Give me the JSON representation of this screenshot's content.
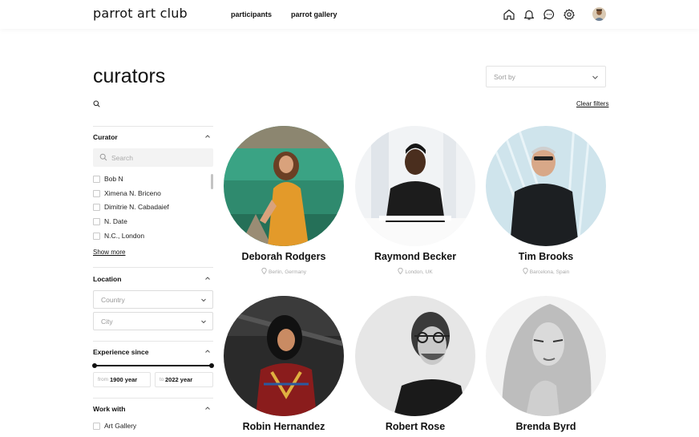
{
  "header": {
    "logo": "parrot art club",
    "nav": [
      "participants",
      "parrot gallery"
    ],
    "icons": [
      "home-icon",
      "bell-icon",
      "chat-icon",
      "gear-icon"
    ]
  },
  "page": {
    "title": "curators",
    "sort_placeholder": "Sort by",
    "clear_filters": "Clear filters"
  },
  "filters": {
    "curator": {
      "title": "Curator",
      "search_placeholder": "Search",
      "options": [
        "Bob N",
        "Ximena N. Briceno",
        "Dimitrie N. Cabadaief",
        "N. Date",
        "N.C., London"
      ],
      "show_more": "Show more"
    },
    "location": {
      "title": "Location",
      "country_placeholder": "Country",
      "city_placeholder": "City"
    },
    "experience": {
      "title": "Experience since",
      "from_label": "from",
      "from_value": "1900 year",
      "to_label": "to",
      "to_value": "2022 year"
    },
    "work_with": {
      "title": "Work with",
      "options": [
        "Art Gallery"
      ]
    }
  },
  "curators": [
    {
      "name": "Deborah Rodgers",
      "location": "Berlin, Germany"
    },
    {
      "name": "Raymond Becker",
      "location": "London, UK"
    },
    {
      "name": "Tim Brooks",
      "location": "Barcelona, Spain"
    },
    {
      "name": "Robin Hernandez",
      "location": ""
    },
    {
      "name": "Robert Rose",
      "location": ""
    },
    {
      "name": "Brenda Byrd",
      "location": ""
    }
  ],
  "colors": {
    "text": "#111111",
    "muted": "#999999",
    "border": "#e3e3e3",
    "search_bg": "#f3f3f3"
  }
}
